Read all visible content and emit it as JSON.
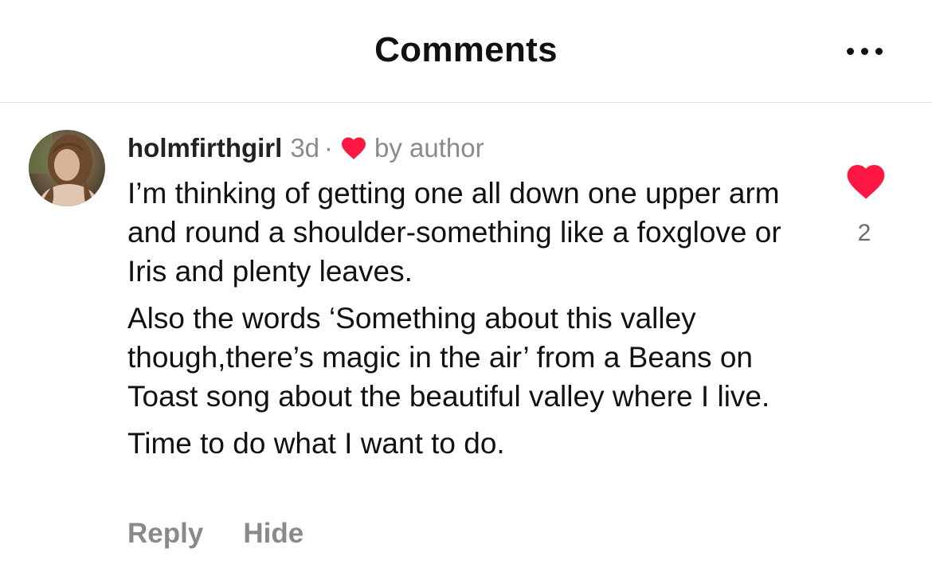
{
  "header": {
    "title": "Comments",
    "more_icon": "more-horizontal-icon"
  },
  "comment": {
    "username": "holmfirthgirl",
    "timestamp": "3d",
    "separator": "·",
    "author_like_icon": "heart-icon",
    "author_like_label": "by author",
    "paragraphs": [
      "I’m thinking of getting one all down one upper arm and round a shoulder-something like a foxglove or Iris and plenty leaves.",
      "Also the words ‘Something about this valley though,there’s magic in the air’ from a Beans on Toast song about the beautiful valley where I live.",
      "Time to do what I want to do."
    ],
    "like_icon": "heart-icon",
    "like_count": "2",
    "actions": {
      "reply": "Reply",
      "hide": "Hide"
    }
  },
  "colors": {
    "heart": "#ff1744",
    "muted_text": "#8a8a8a",
    "divider": "#dcdcdc"
  }
}
